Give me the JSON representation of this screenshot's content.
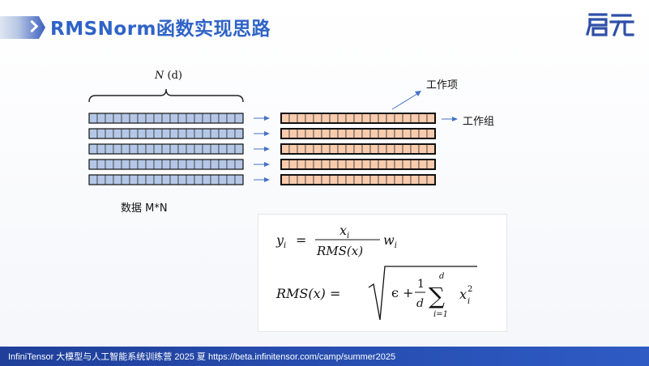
{
  "slide": {
    "title": "RMSNorm函数实现思路",
    "logo_text": "启元"
  },
  "diagram": {
    "dimension_label_var": "N",
    "dimension_label_suffix": "(d)",
    "data_label": "数据 M*N",
    "work_item_label": "工作项",
    "work_group_label": "工作组",
    "rows": 5,
    "cells_per_row": 19,
    "input_color": "#b4c7e7",
    "output_color": "#f8cbad",
    "arrow_color": "#4472c4"
  },
  "formula": {
    "line1_lhs": "y",
    "line1_lhs_sub": "i",
    "numerator": "x",
    "numerator_sub": "i",
    "denominator": "RMS(x)",
    "weight": "w",
    "weight_sub": "i",
    "line2_lhs": "RMS(x) =",
    "epsilon_term": "ϵ +",
    "frac_num": "1",
    "frac_den": "d",
    "sum_top": "d",
    "sum_bottom": "i=1",
    "sum_body": "x",
    "sum_body_sup": "2",
    "sum_body_sub": "i"
  },
  "footer": {
    "text": "InfiniTensor 大模型与人工智能系统训练营 2025 夏    https://beta.infinitensor.com/camp/summer2025"
  }
}
